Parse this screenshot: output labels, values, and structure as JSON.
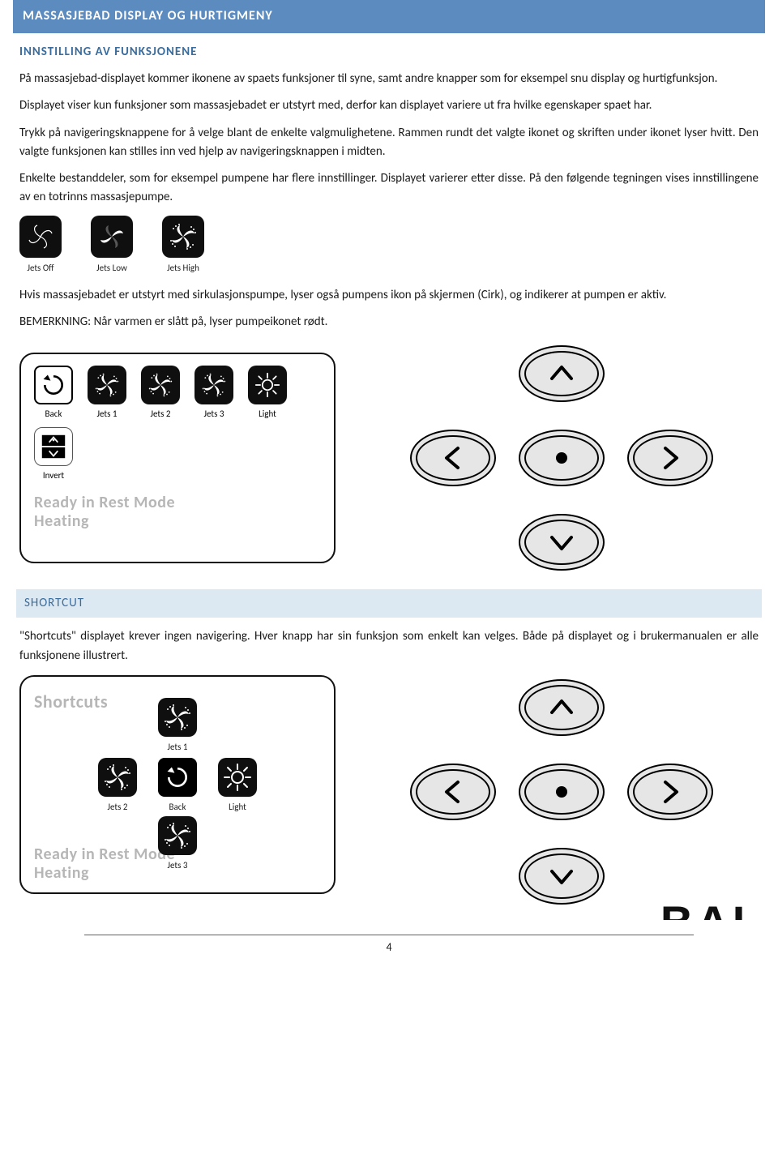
{
  "page_number": "4",
  "header": {
    "banner": "MASSASJEBAD DISPLAY OG HURTIGMENY",
    "section": "INNSTILLING AV FUNKSJONENE"
  },
  "paragraphs": {
    "p1": "På massasjebad-displayet kommer ikonene av spaets funksjoner til syne, samt andre knapper som for eksempel snu display og hurtigfunksjon.",
    "p2": "Displayet viser kun funksjoner som massasjebadet er utstyrt med, derfor kan displayet variere ut fra hvilke egenskaper spaet har.",
    "p3": "Trykk på navigeringsknappene for å velge blant de enkelte valgmulighetene. Rammen rundt det valgte ikonet og skriften under ikonet lyser hvitt. Den valgte funksjonen kan stilles inn ved hjelp av navigeringsknappen i midten.",
    "p4": "Enkelte bestanddeler, som for eksempel pumpene har flere innstillinger. Displayet varierer etter disse. På den følgende tegningen vises innstillingene av en totrinns massasjepumpe.",
    "p5": "Hvis massasjebadet er utstyrt med sirkulasjonspumpe, lyser også pumpens ikon på skjermen (Cirk), og indikerer at pumpen er aktiv.",
    "p6": "BEMERKNING: Når varmen er slått på, lyser pumpeikonet rødt."
  },
  "icon_strip": {
    "i1": "Jets Off",
    "i2": "Jets Low",
    "i3": "Jets High"
  },
  "display_panel": {
    "cells": {
      "back": "Back",
      "jets1": "Jets 1",
      "jets2": "Jets 2",
      "jets3": "Jets 3",
      "light": "Light",
      "invert": "Invert"
    },
    "status_line1": "Ready in Rest Mode",
    "status_line2": "Heating"
  },
  "shortcut": {
    "heading": "SHORTCUT",
    "p1": "\"Shortcuts\" displayet krever ingen navigering. Hver knapp har sin funksjon som enkelt kan velges. Både på displayet og i brukermanualen er alle funksjonene illustrert.",
    "title": "Shortcuts",
    "cells": {
      "jets1": "Jets 1",
      "jets2": "Jets 2",
      "back": "Back",
      "light": "Light",
      "jets3": "Jets 3"
    },
    "status_line1": "Ready in Rest Mode",
    "status_line2": "Heating"
  },
  "brand_partial": "BAL"
}
